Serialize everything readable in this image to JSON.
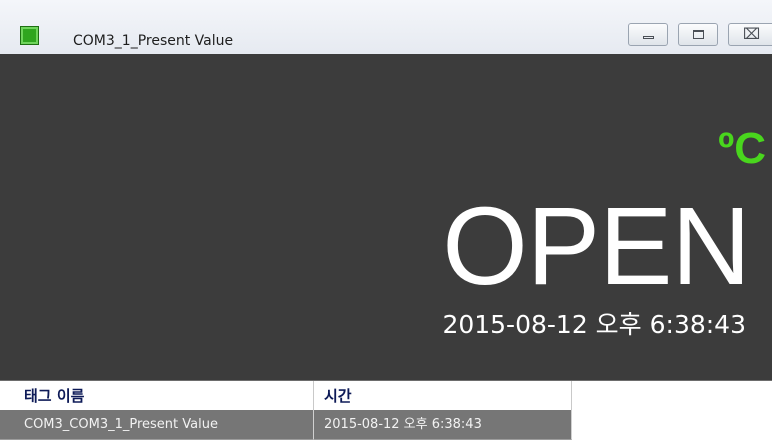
{
  "window": {
    "title": "COM3_1_Present Value",
    "icon": "green-square-icon"
  },
  "titlebar_buttons": {
    "minimize": "minimize-icon",
    "maximize": "maximize-icon",
    "close_glyph": "⌧"
  },
  "display": {
    "unit": "ºC",
    "value": "OPEN",
    "timestamp": "2015-08-12 오후 6:38:43",
    "colors": {
      "background": "#3c3c3c",
      "unit": "#49d61d",
      "value": "#ffffff"
    }
  },
  "grid": {
    "columns": [
      "태그 이름",
      "시간"
    ],
    "rows": [
      {
        "tag_name": "COM3_COM3_1_Present Value",
        "time": "2015-08-12 오후 6:38:43"
      }
    ]
  }
}
